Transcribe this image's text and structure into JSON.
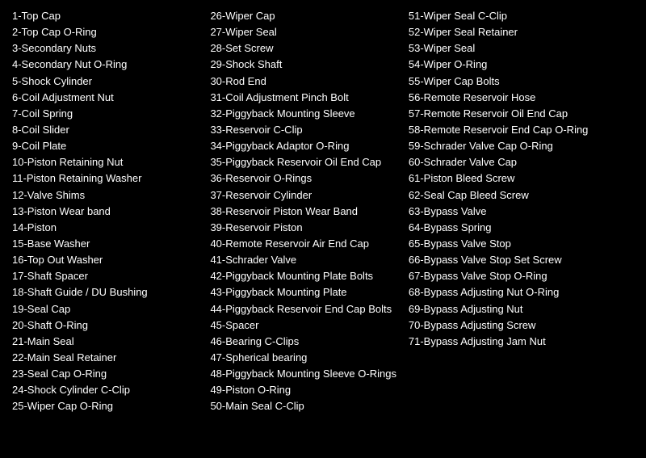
{
  "columns": [
    {
      "id": "col1",
      "items": [
        "1-Top Cap",
        "2-Top Cap O-Ring",
        "3-Secondary Nuts",
        "4-Secondary Nut O-Ring",
        "5-Shock Cylinder",
        "6-Coil Adjustment Nut",
        "7-Coil Spring",
        "8-Coil Slider",
        "9-Coil Plate",
        "10-Piston Retaining Nut",
        "11-Piston Retaining Washer",
        "12-Valve Shims",
        "13-Piston Wear band",
        "14-Piston",
        "15-Base Washer",
        "16-Top Out Washer",
        "17-Shaft Spacer",
        "18-Shaft Guide / DU Bushing",
        "19-Seal Cap",
        "20-Shaft O-Ring",
        "21-Main Seal",
        "22-Main Seal Retainer",
        "23-Seal Cap O-Ring",
        "24-Shock Cylinder C-Clip",
        "25-Wiper Cap O-Ring"
      ]
    },
    {
      "id": "col2",
      "items": [
        "26-Wiper Cap",
        "27-Wiper Seal",
        "28-Set Screw",
        "29-Shock Shaft",
        "30-Rod End",
        "31-Coil Adjustment Pinch Bolt",
        "32-Piggyback Mounting Sleeve",
        "33-Reservoir C-Clip",
        "34-Piggyback Adaptor O-Ring",
        "35-Piggyback Reservoir Oil End Cap",
        "36-Reservoir O-Rings",
        "37-Reservoir Cylinder",
        "38-Reservoir Piston Wear Band",
        "39-Reservoir Piston",
        "40-Remote Reservoir Air End Cap",
        "41-Schrader Valve",
        "42-Piggyback Mounting Plate Bolts",
        "43-Piggyback Mounting Plate",
        "44-Piggyback Reservoir End Cap Bolts",
        "45-Spacer",
        "46-Bearing C-Clips",
        "47-Spherical bearing",
        "48-Piggyback Mounting Sleeve O-Rings",
        "49-Piston O-Ring",
        "50-Main Seal C-Clip"
      ]
    },
    {
      "id": "col3",
      "items": [
        "51-Wiper Seal C-Clip",
        "52-Wiper Seal Retainer",
        "53-Wiper Seal",
        "54-Wiper O-Ring",
        "55-Wiper Cap Bolts",
        "56-Remote Reservoir Hose",
        "57-Remote Reservoir Oil End Cap",
        "58-Remote Reservoir End Cap O-Ring",
        "59-Schrader Valve Cap O-Ring",
        "60-Schrader Valve Cap",
        "61-Piston Bleed Screw",
        "62-Seal Cap Bleed Screw",
        "63-Bypass Valve",
        "64-Bypass Spring",
        "65-Bypass Valve Stop",
        "66-Bypass Valve Stop Set Screw",
        "67-Bypass Valve Stop O-Ring",
        "68-Bypass Adjusting Nut O-Ring",
        "69-Bypass Adjusting Nut",
        "70-Bypass Adjusting Screw",
        "71-Bypass Adjusting Jam Nut"
      ]
    }
  ]
}
